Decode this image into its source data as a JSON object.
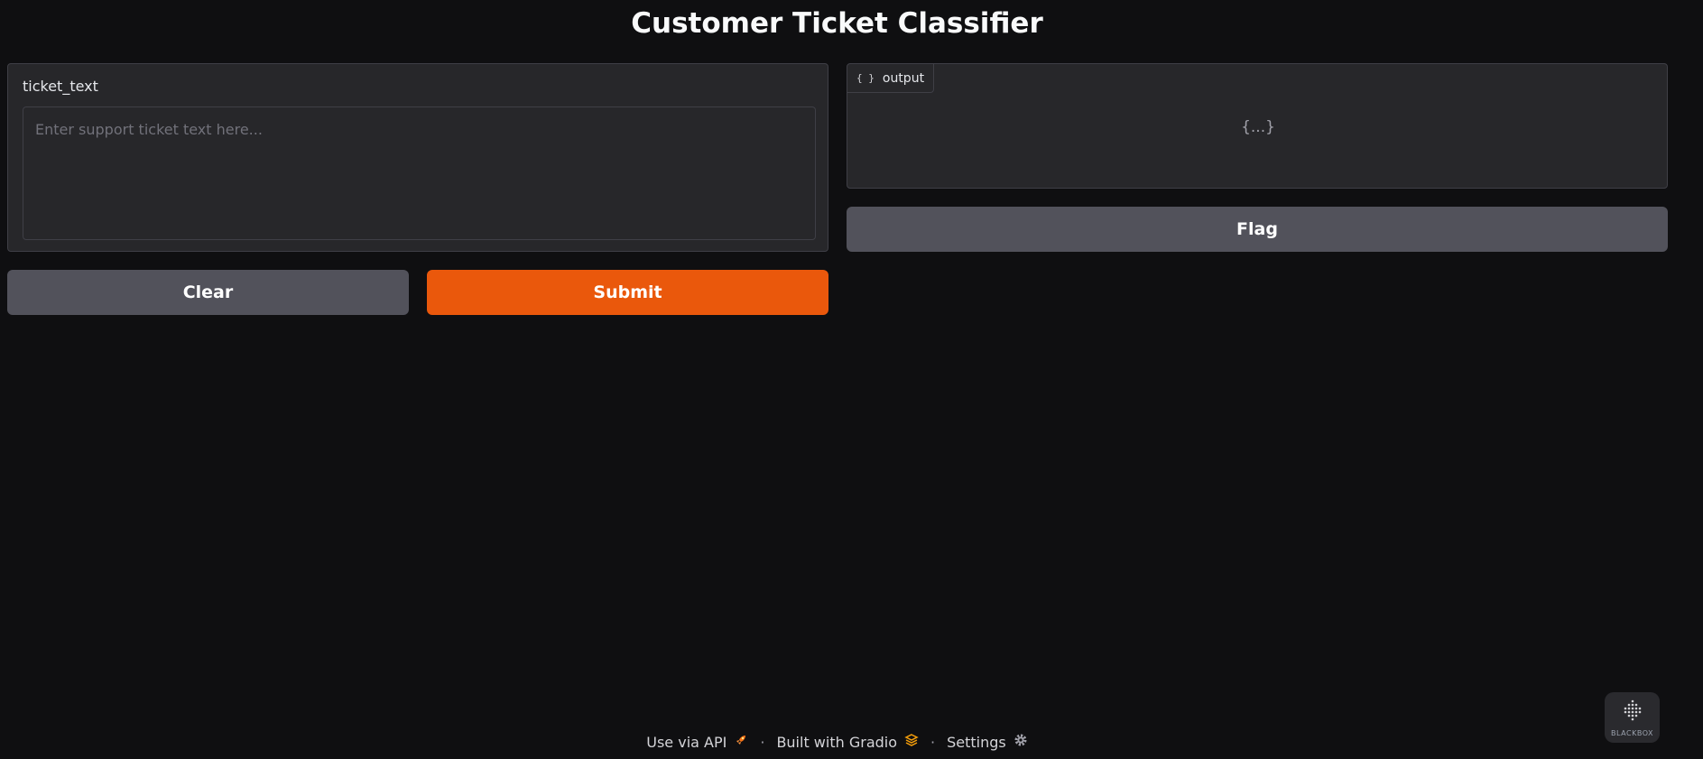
{
  "app": {
    "title": "Customer Ticket Classifier"
  },
  "input": {
    "label": "ticket_text",
    "placeholder": "Enter support ticket text here...",
    "value": ""
  },
  "buttons": {
    "clear": "Clear",
    "submit": "Submit",
    "flag": "Flag"
  },
  "output": {
    "label": "output",
    "icon": "braces-icon",
    "empty_placeholder": "{...}"
  },
  "footer": {
    "api_link": "Use via API",
    "api_icon": "rocket-icon",
    "built_with": "Built with Gradio",
    "gradio_icon": "gradio-logo-icon",
    "settings": "Settings",
    "settings_icon": "gear-icon",
    "separator": "·"
  },
  "badge": {
    "label": "BLACKBOX"
  },
  "colors": {
    "background": "#0f0f11",
    "panel": "#27272a",
    "primary": "#ea580c",
    "secondary": "#52525b"
  }
}
